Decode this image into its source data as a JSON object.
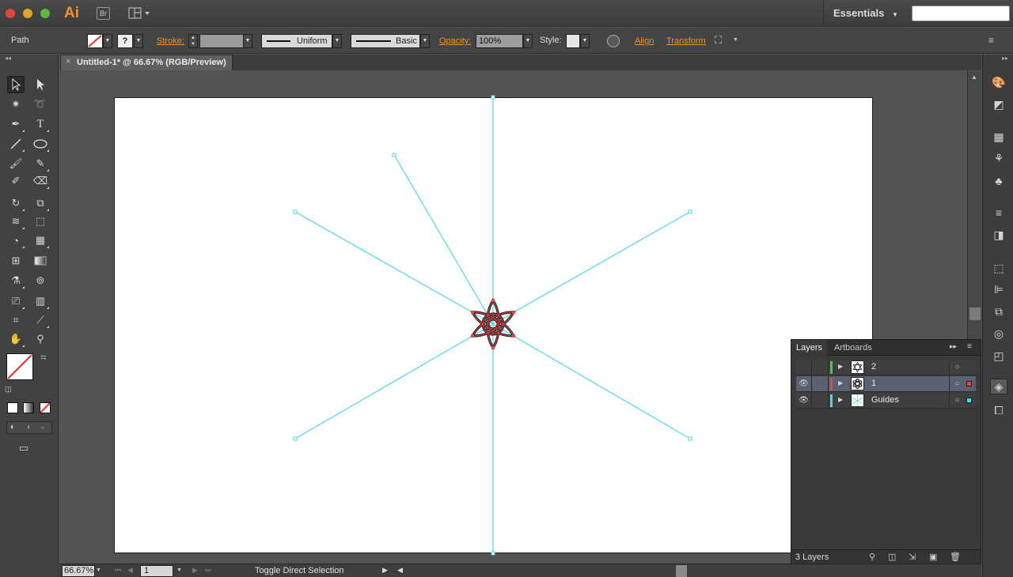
{
  "app": {
    "logo": "Ai",
    "bridge_label": "Br",
    "workspace": "Essentials",
    "search_placeholder": ""
  },
  "control_bar": {
    "selection_kind": "Path",
    "stroke_label": "Stroke:",
    "stroke_profile": "Uniform",
    "brush": "Basic",
    "opacity_label": "Opacity:",
    "opacity_value": "100%",
    "style_label": "Style:",
    "fill_unknown": "?",
    "align_label": "Align",
    "transform_label": "Transform"
  },
  "document": {
    "tab_title": "Untitled-1* @ 66.67% (RGB/Preview)",
    "close_glyph": "×"
  },
  "layers_panel": {
    "tabs": [
      "Layers",
      "Artboards"
    ],
    "layers": [
      {
        "name": "2",
        "color": "#3bd33b",
        "visible": false,
        "selected": false
      },
      {
        "name": "1",
        "color": "#e8454a",
        "visible": true,
        "selected": true
      },
      {
        "name": "Guides",
        "color": "#4bd9e8",
        "visible": true,
        "selected": false
      }
    ],
    "count_label": "3 Layers"
  },
  "status_bar": {
    "zoom": "66.67%",
    "artboard_number": "1",
    "tool_status": "Toggle Direct Selection"
  },
  "colors": {
    "accent_orange": "#f2931d",
    "guide_cyan": "#4bd9e8",
    "selection_red": "#e8454a"
  }
}
